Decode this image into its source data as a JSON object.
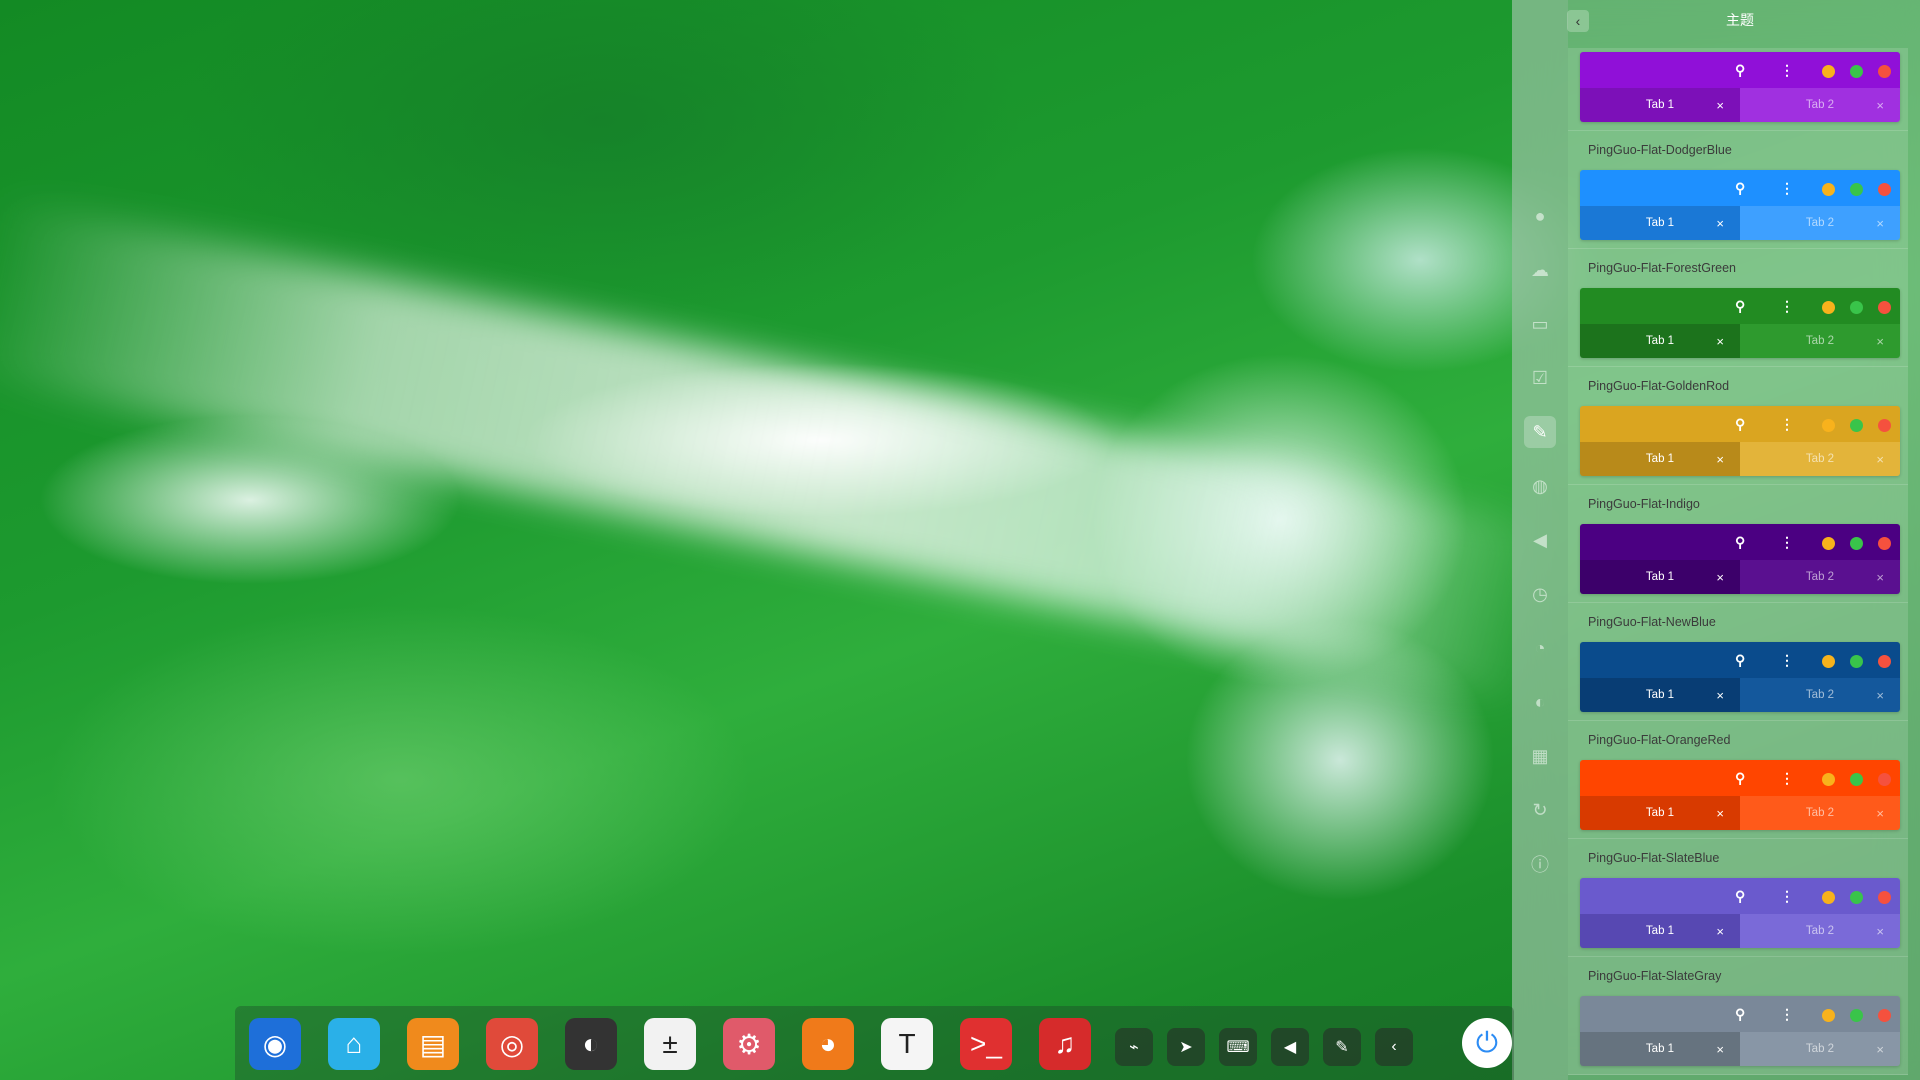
{
  "control_center": {
    "title": "主题",
    "nav_icons": [
      "account-icon",
      "cloud-icon",
      "display-icon",
      "default-apps-icon",
      "personalization-icon",
      "network-icon",
      "sound-icon",
      "time-icon",
      "power-icon",
      "mouse-icon",
      "keyboard-icon",
      "update-icon",
      "info-icon"
    ],
    "active_nav": "personalization-icon",
    "themes": [
      {
        "name": "",
        "primary": "#9010d8",
        "tab1": "#7c10b8",
        "tab2": "#a030e0"
      },
      {
        "name": "PingGuo-Flat-DodgerBlue",
        "primary": "#1e90ff",
        "tab1": "#1a78d6",
        "tab2": "#3ea0ff"
      },
      {
        "name": "PingGuo-Flat-ForestGreen",
        "primary": "#228b22",
        "tab1": "#1c731c",
        "tab2": "#2e9a2e"
      },
      {
        "name": "PingGuo-Flat-GoldenRod",
        "primary": "#daa520",
        "tab1": "#b88a1a",
        "tab2": "#e3b43a"
      },
      {
        "name": "PingGuo-Flat-Indigo",
        "primary": "#4b0082",
        "tab1": "#3c006a",
        "tab2": "#5a1090"
      },
      {
        "name": "PingGuo-Flat-NewBlue",
        "primary": "#0a4b8c",
        "tab1": "#083d74",
        "tab2": "#14589c"
      },
      {
        "name": "PingGuo-Flat-OrangeRed",
        "primary": "#ff4500",
        "tab1": "#d83a00",
        "tab2": "#ff5a1a"
      },
      {
        "name": "PingGuo-Flat-SlateBlue",
        "primary": "#6a5acd",
        "tab1": "#5748b2",
        "tab2": "#7a6ad8"
      },
      {
        "name": "PingGuo-Flat-SlateGray",
        "primary": "#7a8899",
        "tab1": "#66737f",
        "tab2": "#8896a6"
      }
    ],
    "tab1_label": "Tab 1",
    "tab2_label": "Tab 2",
    "close_glyph": "×"
  },
  "dock": {
    "apps": [
      {
        "name": "launcher-icon",
        "glyph": "◉",
        "color": "#1e6fd9"
      },
      {
        "name": "file-manager-icon",
        "glyph": "⌂",
        "color": "#2ab0e8"
      },
      {
        "name": "app-store-icon",
        "glyph": "▤",
        "color": "#f08a1c"
      },
      {
        "name": "chrome-icon",
        "glyph": "◎",
        "color": "#e04a3a"
      },
      {
        "name": "system-monitor-icon",
        "glyph": "◐",
        "color": "#333333"
      },
      {
        "name": "calculator-icon",
        "glyph": "±",
        "color": "#f2f2f2"
      },
      {
        "name": "settings-icon",
        "glyph": "⚙",
        "color": "#e05a6a"
      },
      {
        "name": "firefox-icon",
        "glyph": "◕",
        "color": "#f07a1a"
      },
      {
        "name": "text-editor-icon",
        "glyph": "T",
        "color": "#f5f5f5"
      },
      {
        "name": "terminal-icon",
        "glyph": ">_",
        "color": "#e03030"
      },
      {
        "name": "netease-music-icon",
        "glyph": "♫",
        "color": "#d62b2b"
      }
    ],
    "tray": [
      {
        "name": "usb-icon",
        "glyph": "⌁"
      },
      {
        "name": "telegram-icon",
        "glyph": "➤"
      },
      {
        "name": "keyboard-tray-icon",
        "glyph": "⌨"
      },
      {
        "name": "volume-icon",
        "glyph": "◀"
      },
      {
        "name": "pen-icon",
        "glyph": "✎"
      },
      {
        "name": "expand-tray-icon",
        "glyph": "‹"
      }
    ],
    "power_glyph": "⏻"
  }
}
